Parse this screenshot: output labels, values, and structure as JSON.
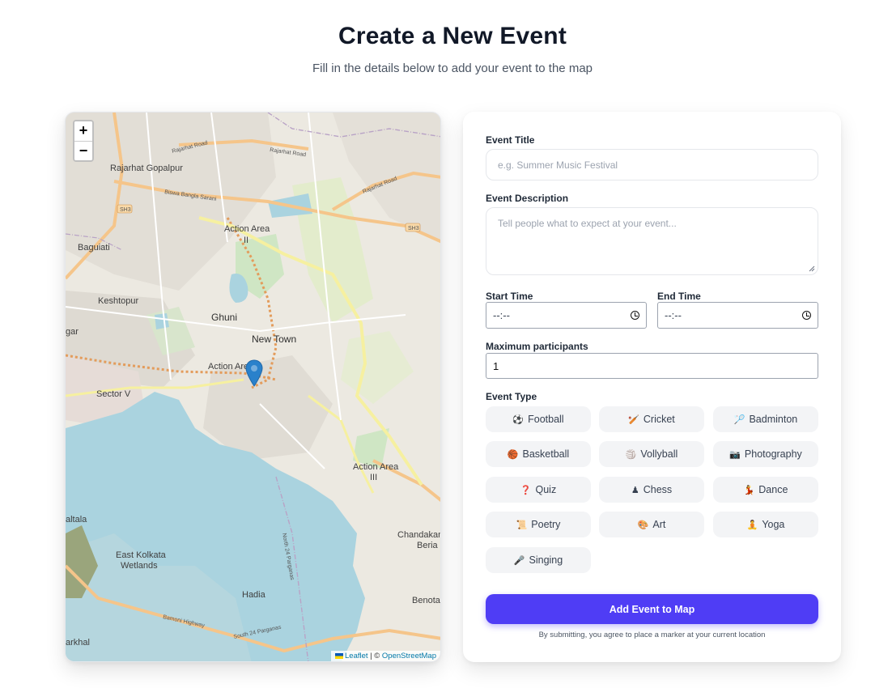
{
  "header": {
    "title": "Create a New Event",
    "subtitle": "Fill in the details below to add your event to the map"
  },
  "map": {
    "zoom_in_label": "+",
    "zoom_out_label": "−",
    "attribution": {
      "leaflet": "Leaflet",
      "separator": " | © ",
      "osm": "OpenStreetMap"
    },
    "place_labels": {
      "rajarhat_gopalpur": "Rajarhat Gopalpur",
      "baguiati": "Baguiati",
      "keshtopur": "Keshtopur",
      "action_area_ii": "Action Area",
      "ii": "II",
      "ghuni": "Ghuni",
      "new_town": "New Town",
      "action_area_i": "Action Area",
      "sector_v": "Sector V",
      "action_area_iii": "Action Area",
      "iii": "III",
      "chandakan": "Chandakan",
      "beria": "Beria",
      "east_kolkata": "East Kolkata",
      "wetlands": "Wetlands",
      "hadia": "Hadia",
      "benota": "Benota",
      "gar": "gar",
      "altala": "altala",
      "arkhal": "arkhal"
    },
    "road_labels": {
      "rajarhat_road_1": "Rajarhat Road",
      "rajarhat_road_2": "Rajarhat Road",
      "rajarhat_road_3": "Rajarhat Road",
      "biswa_bangla": "Biswa Bangla Sarani",
      "sh3_left": "SH3",
      "sh3_right": "SH3",
      "bamoni": "Bamoni Highway",
      "north24": "North 24 Parganas",
      "south24": "South 24 Parganas"
    }
  },
  "form": {
    "title_label": "Event Title",
    "title_placeholder": "e.g. Summer Music Festival",
    "description_label": "Event Description",
    "description_placeholder": "Tell people what to expect at your event...",
    "start_label": "Start Time",
    "start_value": "--:--",
    "end_label": "End Time",
    "end_value": "--:--",
    "max_label": "Maximum participants",
    "max_value": "1",
    "type_label": "Event Type",
    "types": [
      {
        "emoji": "⚽",
        "label": "Football"
      },
      {
        "emoji": "🏏",
        "label": "Cricket"
      },
      {
        "emoji": "🏸",
        "label": "Badminton"
      },
      {
        "emoji": "🏀",
        "label": "Basketball"
      },
      {
        "emoji": "🏐",
        "label": "Vollyball"
      },
      {
        "emoji": "📷",
        "label": "Photography"
      },
      {
        "emoji": "❓",
        "label": "Quiz"
      },
      {
        "emoji": "♟",
        "label": "Chess"
      },
      {
        "emoji": "💃",
        "label": "Dance"
      },
      {
        "emoji": "📜",
        "label": "Poetry"
      },
      {
        "emoji": "🎨",
        "label": "Art"
      },
      {
        "emoji": "🧘",
        "label": "Yoga"
      },
      {
        "emoji": "🎤",
        "label": "Singing"
      }
    ],
    "submit_label": "Add Event to Map",
    "note": "By submitting, you agree to place a marker at your current location"
  },
  "colors": {
    "accent": "#4f3df5",
    "marker": "#2a81cb",
    "water": "#aad3df",
    "land": "#ece9e1"
  }
}
